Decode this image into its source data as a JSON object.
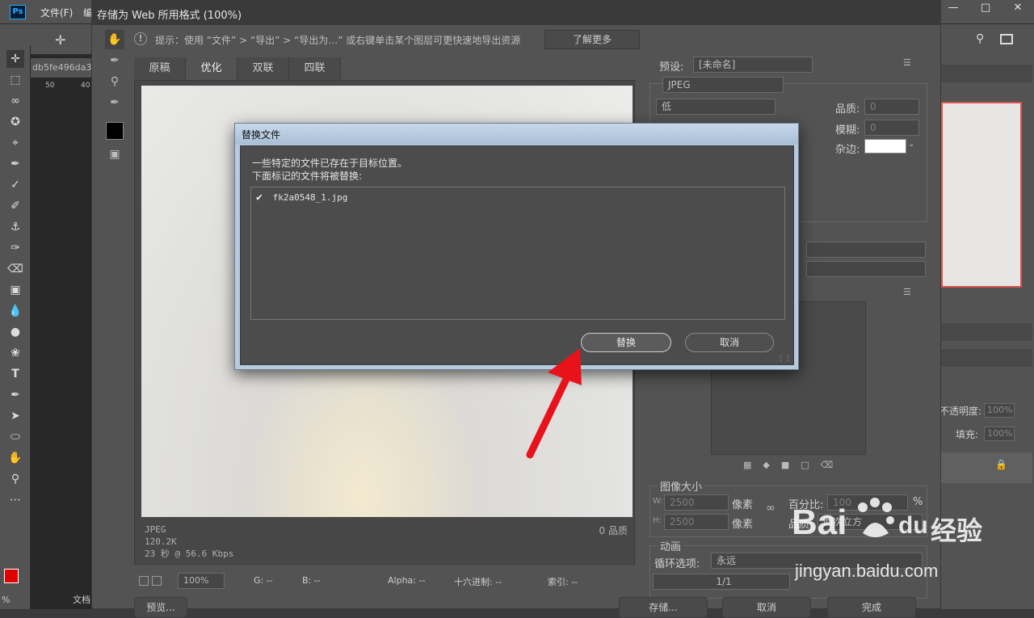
{
  "photoshop": {
    "logo": "Ps",
    "menu": {
      "file": "文件(F)",
      "edit_partial": "编"
    },
    "doc_tab": "db5fe496da3",
    "ruler_marks": [
      "50",
      "40"
    ],
    "opacity_label": "不透明度:",
    "opacity_value": "100%",
    "fill_label": "填充:",
    "fill_value": "100%",
    "left_bottom_labels": [
      "%",
      "文档"
    ]
  },
  "save_for_web": {
    "title": "存储为 Web 所用格式 (100%)",
    "hint": "提示：使用 “文件” > “导出” > “导出为…” 或右键单击某个图层可更快速地导出资源",
    "learn_more": "了解更多",
    "tabs": [
      "原稿",
      "优化",
      "双联",
      "四联"
    ],
    "active_tab": "优化",
    "preview_info": {
      "format": "JPEG",
      "size": "120.2K",
      "speed": "23 秒 @ 56.6 Kbps",
      "quality_note": "0 品质"
    },
    "status": {
      "zoom": "100%",
      "g": "G: --",
      "b": "B: --",
      "alpha": "Alpha: --",
      "hex": "十六进制: --",
      "index": "索引: --"
    },
    "settings": {
      "preset_label": "预设:",
      "preset_value": "[未命名]",
      "format_value": "JPEG",
      "quality_level": "低",
      "quality_label": "品质:",
      "quality_value": "0",
      "blur_label": "模糊:",
      "blur_value": "0",
      "matte_label": "杂边:"
    },
    "image_size": {
      "title": "图像大小",
      "w_label": "W:",
      "w_value": "2500",
      "h_label": "H:",
      "h_value": "2500",
      "unit": "像素",
      "percent_label": "百分比:",
      "percent_value": "100",
      "percent_unit": "%",
      "quality_label": "品质:",
      "quality_value": "两次立方"
    },
    "animation": {
      "title": "动画",
      "loop_label": "循环选项:",
      "loop_value": "永远",
      "frame": "1/1"
    },
    "bottom_buttons": {
      "preview": "预览...",
      "save": "存储...",
      "cancel": "取消",
      "done": "完成"
    }
  },
  "replace_dialog": {
    "title": "替换文件",
    "line1": "一些特定的文件已存在于目标位置。",
    "line2": "下面标记的文件将被替换:",
    "files": [
      {
        "checked": true,
        "name": "fk2a0548_1.jpg"
      }
    ],
    "replace_button": "替换",
    "cancel_button": "取消"
  },
  "annotation": {
    "arrow_color": "#e8121b"
  },
  "watermark": {
    "brand": "Bai",
    "brand2": "du",
    "cn": "经验",
    "url": "jingyan.baidu.com"
  }
}
